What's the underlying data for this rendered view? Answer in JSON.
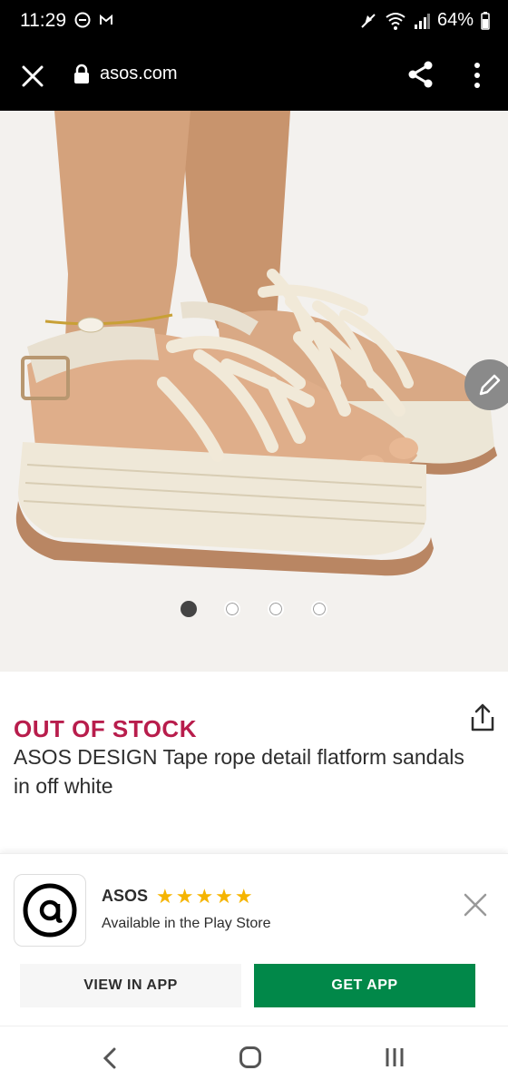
{
  "status": {
    "time": "11:29",
    "battery": "64%"
  },
  "browser": {
    "url": "asos.com"
  },
  "product": {
    "stock_status": "OUT OF STOCK",
    "title": "ASOS DESIGN Tape rope detail flatform sandals in off white",
    "carousel": {
      "total": 4,
      "active_index": 0
    }
  },
  "app_banner": {
    "app_name": "ASOS",
    "rating_stars": "★★★★★",
    "rating": 5,
    "store_text": "Available in the Play Store",
    "view_label": "VIEW IN APP",
    "get_label": "GET APP"
  },
  "colors": {
    "stock_red": "#b81d4c",
    "get_app_green": "#018849",
    "star_yellow": "#f5b400"
  },
  "icons": [
    "close-icon",
    "lock-icon",
    "share-icon",
    "more-icon",
    "edit-icon",
    "upload-icon",
    "asos-a-icon",
    "back-icon",
    "home-icon",
    "recent-apps-icon"
  ]
}
